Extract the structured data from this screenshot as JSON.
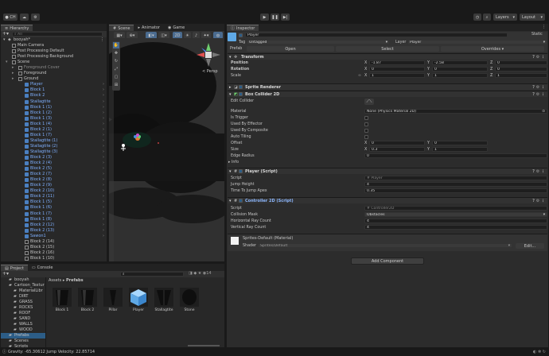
{
  "toolbar": {
    "account": "CH",
    "layers": "Layers",
    "layout": "Layout"
  },
  "hierarchy": {
    "tab": "Hierarchy",
    "search_placeholder": "All",
    "scene": "booyah*",
    "rows": [
      {
        "label": "Main Camera",
        "style": "n"
      },
      {
        "label": "Post Processing Default",
        "style": "n"
      },
      {
        "label": "Post Processing Background",
        "style": "n"
      },
      {
        "label": "Scene",
        "style": "n"
      },
      {
        "label": "Foreground Cover",
        "style": "d"
      },
      {
        "label": "Foreground",
        "style": "n"
      },
      {
        "label": "Ground",
        "style": "n"
      },
      {
        "label": "Player",
        "style": "h"
      },
      {
        "label": "Block 1",
        "style": "h"
      },
      {
        "label": "Block 2",
        "style": "h"
      },
      {
        "label": "Stallagtite",
        "style": "h"
      },
      {
        "label": "Block 1 (1)",
        "style": "h"
      },
      {
        "label": "Block 1 (2)",
        "style": "h"
      },
      {
        "label": "Block 1 (3)",
        "style": "h"
      },
      {
        "label": "Block 1 (4)",
        "style": "h"
      },
      {
        "label": "Block 2 (1)",
        "style": "h"
      },
      {
        "label": "Block 1 (7)",
        "style": "h"
      },
      {
        "label": "Stallagtite (1)",
        "style": "h"
      },
      {
        "label": "Stallagtite (2)",
        "style": "h"
      },
      {
        "label": "Stallagtite (3)",
        "style": "h"
      },
      {
        "label": "Block 2 (3)",
        "style": "h"
      },
      {
        "label": "Block 2 (4)",
        "style": "h"
      },
      {
        "label": "Block 2 (5)",
        "style": "h"
      },
      {
        "label": "Block 2 (7)",
        "style": "h"
      },
      {
        "label": "Block 2 (8)",
        "style": "h"
      },
      {
        "label": "Block 2 (9)",
        "style": "h"
      },
      {
        "label": "Block 2 (10)",
        "style": "h"
      },
      {
        "label": "Block 2 (11)",
        "style": "h"
      },
      {
        "label": "Block 1 (5)",
        "style": "h"
      },
      {
        "label": "Block 1 (6)",
        "style": "h"
      },
      {
        "label": "Block 1 (7)",
        "style": "h"
      },
      {
        "label": "Block 1 (8)",
        "style": "h"
      },
      {
        "label": "Block 2 (12)",
        "style": "h"
      },
      {
        "label": "Block 2 (13)",
        "style": "h"
      },
      {
        "label": "Sawon1",
        "style": "h"
      },
      {
        "label": "Block 2 (14)",
        "style": "n"
      },
      {
        "label": "Block 2 (15)",
        "style": "n"
      },
      {
        "label": "Block 2 (16)",
        "style": "n"
      },
      {
        "label": "Block 1 (10)",
        "style": "n"
      },
      {
        "label": "Block 2 (17)",
        "style": "n"
      },
      {
        "label": "Enemy",
        "style": "n"
      }
    ]
  },
  "scene": {
    "tab_scene": "Scene",
    "tab_animator": "Animator",
    "tab_game": "Game",
    "mode_2d": "2D",
    "persp": "< Persp"
  },
  "project": {
    "tab_project": "Project",
    "tab_console": "Console",
    "breadcrumb_root": "Assets",
    "breadcrumb_current": "Prefabs",
    "tree": [
      {
        "label": "booyah",
        "level": 1
      },
      {
        "label": "Cartoon_Textur",
        "level": 1
      },
      {
        "label": "MaterialLibr",
        "level": 2
      },
      {
        "label": "DIRT",
        "level": 2
      },
      {
        "label": "GRASS",
        "level": 2
      },
      {
        "label": "ROCKS",
        "level": 2
      },
      {
        "label": "ROOF",
        "level": 2
      },
      {
        "label": "SAND",
        "level": 2
      },
      {
        "label": "WALLS",
        "level": 2
      },
      {
        "label": "WOOD",
        "level": 2
      },
      {
        "label": "Prefabs",
        "level": 1
      },
      {
        "label": "Scenes",
        "level": 1
      },
      {
        "label": "Scripts",
        "level": 1
      }
    ],
    "packages": "Packages",
    "assets": [
      "Block 1",
      "Block 2",
      "Pillar",
      "Player",
      "Stallagtite",
      "Stone"
    ],
    "count": "14"
  },
  "inspector": {
    "tab": "Inspector",
    "name": "Player",
    "static": "Static",
    "tag_label": "Tag",
    "tag_value": "Untagged",
    "layer_label": "Layer",
    "layer_value": "Player",
    "prefab_label": "Prefab",
    "prefab_open": "Open",
    "prefab_select": "Select",
    "prefab_overrides": "Overrides",
    "transform": {
      "title": "Transform",
      "position": "Position",
      "rotation": "Rotation",
      "scale": "Scale",
      "pos": [
        "-1.87",
        "-2.58",
        "0"
      ],
      "rot": [
        "0",
        "0",
        "0"
      ],
      "scl": [
        "1",
        "1",
        "1"
      ]
    },
    "sprite_renderer": "Sprite Renderer",
    "box_collider": {
      "title": "Box Collider 2D",
      "edit_collider": "Edit Collider",
      "material": "Material",
      "material_value": "None (Physics Material 2D)",
      "is_trigger": "Is Trigger",
      "used_by_effector": "Used By Effector",
      "used_by_composite": "Used By Composite",
      "auto_tiling": "Auto Tiling",
      "offset": "Offset",
      "offset_x": "0",
      "offset_y": "0",
      "size": "Size",
      "size_x": "0.3",
      "size_y": "1",
      "edge_radius": "Edge Radius",
      "edge_radius_value": "0",
      "info": "Info"
    },
    "player_script": {
      "title": "Player (Script)",
      "script_label": "Script",
      "script_value": "Player",
      "jump_height": "Jump Height",
      "jump_height_value": "4",
      "time_to_apex": "Time To Jump Apex",
      "time_to_apex_value": "0.35"
    },
    "controller": {
      "title": "Controller 2D (Script)",
      "script_label": "Script",
      "script_value": "Controller2D",
      "collision_mask": "Collision Mask",
      "collision_mask_value": "Obstacles",
      "h_ray": "Horizontal Ray Count",
      "h_ray_value": "4",
      "v_ray": "Vertical Ray Count",
      "v_ray_value": "4"
    },
    "material": {
      "title": "Sprites-Default (Material)",
      "shader_label": "Shader",
      "shader_value": "Sprites/Default",
      "edit": "Edit..."
    },
    "add_component": "Add Component"
  },
  "status": {
    "text": "Gravity: -65.30612 Jump Velocity: 22.85714"
  },
  "colors": {
    "accent": "#4a90e2",
    "highlight_text": "#7fb0ff",
    "selection": "#2c5d87"
  }
}
